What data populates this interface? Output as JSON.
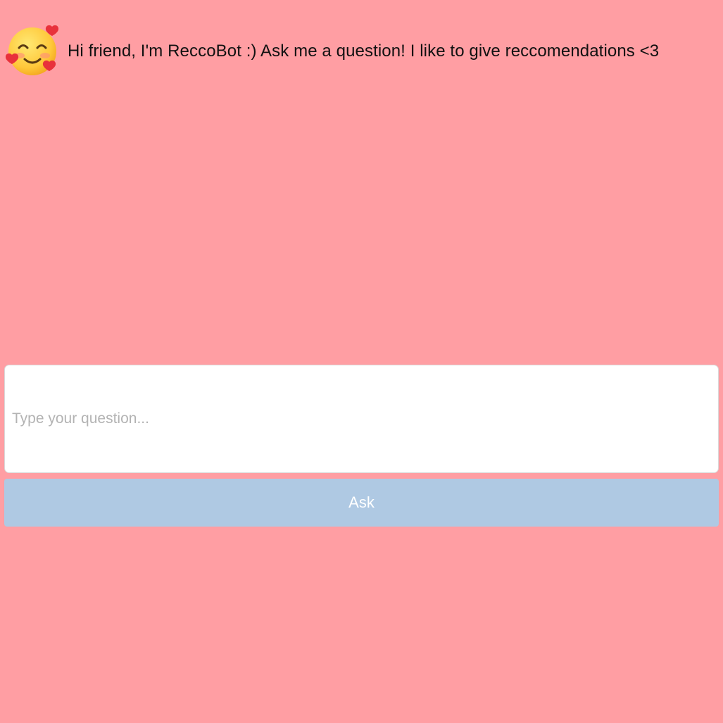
{
  "header": {
    "avatar_icon": "smiling-face-with-hearts-icon",
    "greeting": "Hi friend, I'm ReccoBot :) Ask me a question! I like to give reccomendations <3"
  },
  "form": {
    "question_placeholder": "Type your question...",
    "question_value": "",
    "ask_label": "Ask"
  },
  "colors": {
    "background": "#ff9ea3",
    "button": "#afc9e3",
    "button_text": "#ffffff",
    "input_background": "#ffffff",
    "placeholder": "#b3b3b3"
  }
}
